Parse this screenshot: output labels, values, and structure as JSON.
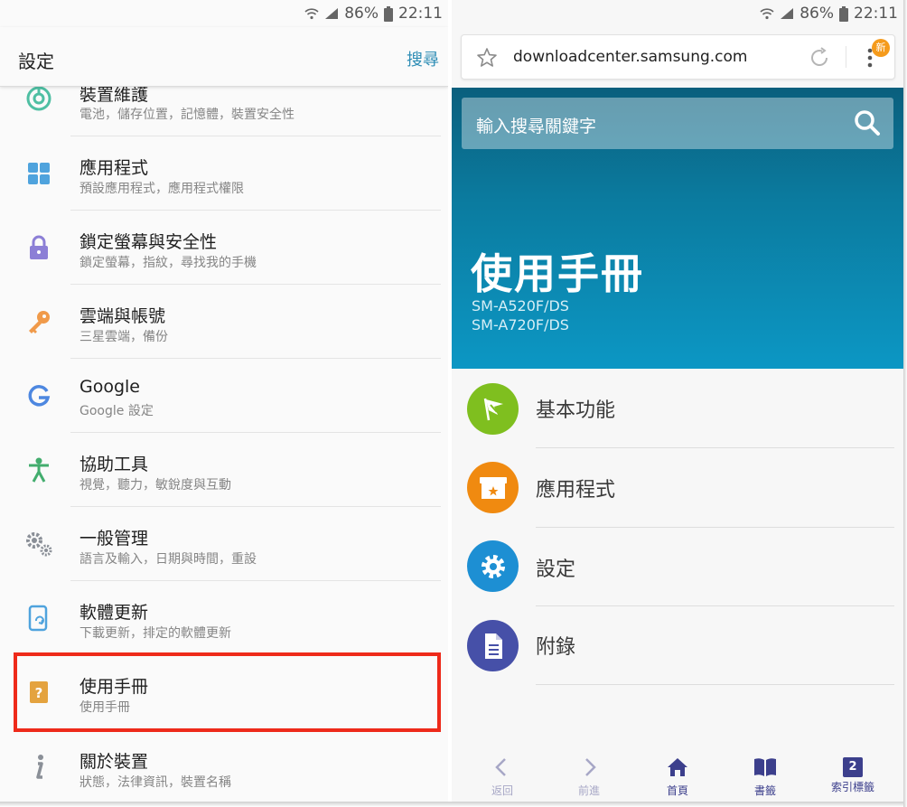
{
  "status_bar": {
    "battery": "86%",
    "time": "22:11"
  },
  "settings": {
    "title": "設定",
    "search_label": "搜尋",
    "items": [
      {
        "title": "裝置維護",
        "subtitle": "電池，儲存位置，記憶體，裝置安全性",
        "icon": "device-maintenance-icon",
        "color": "#4fbfa3"
      },
      {
        "title": "應用程式",
        "subtitle": "預設應用程式，應用程式權限",
        "icon": "apps-grid-icon",
        "color": "#4fa3dd"
      },
      {
        "title": "鎖定螢幕與安全性",
        "subtitle": "鎖定螢幕，指紋，尋找我的手機",
        "icon": "lock-icon",
        "color": "#8c7fd6"
      },
      {
        "title": "雲端與帳號",
        "subtitle": "三星雲端，備份",
        "icon": "key-icon",
        "color": "#f09a4a"
      },
      {
        "title": "Google",
        "subtitle": "Google 設定",
        "icon": "google-icon",
        "color": "#4d87e0"
      },
      {
        "title": "協助工具",
        "subtitle": "視覺，聽力，敏銳度與互動",
        "icon": "accessibility-icon",
        "color": "#43ad6e"
      },
      {
        "title": "一般管理",
        "subtitle": "語言及輸入，日期與時間，重設",
        "icon": "gears-icon",
        "color": "#8a8f97"
      },
      {
        "title": "軟體更新",
        "subtitle": "下載更新，排定的軟體更新",
        "icon": "software-update-icon",
        "color": "#4fa3dd"
      },
      {
        "title": "使用手冊",
        "subtitle": "使用手冊",
        "icon": "user-manual-icon",
        "color": "#e4a33f"
      },
      {
        "title": "關於裝置",
        "subtitle": "狀態，法律資訊，裝置名稱",
        "icon": "info-icon",
        "color": "#8a8f97"
      }
    ]
  },
  "browser": {
    "url": "downloadcenter.samsung.com",
    "new_badge": "新",
    "search_placeholder": "輸入搜尋關鍵字",
    "page_title": "使用手冊",
    "models": [
      "SM-A520F/DS",
      "SM-A720F/DS"
    ],
    "menu": [
      {
        "label": "基本功能",
        "icon": "flag-icon",
        "color": "#7fbf1f"
      },
      {
        "label": "應用程式",
        "icon": "app-box-icon",
        "color": "#f08a10"
      },
      {
        "label": "設定",
        "icon": "gear-icon",
        "color": "#1d8fd3"
      },
      {
        "label": "附錄",
        "icon": "document-icon",
        "color": "#4650a8"
      }
    ],
    "bottom_nav": [
      {
        "label": "返回",
        "icon": "back-arrow-icon",
        "enabled": false
      },
      {
        "label": "前進",
        "icon": "forward-arrow-icon",
        "enabled": false
      },
      {
        "label": "首頁",
        "icon": "home-icon",
        "enabled": true
      },
      {
        "label": "書籤",
        "icon": "bookmark-book-icon",
        "enabled": true
      },
      {
        "label": "索引標籤",
        "icon": "tabs-icon",
        "enabled": true,
        "count": "2"
      }
    ]
  },
  "colors": {
    "accent": "#2e8db5",
    "highlight_border": "#ee2a1a",
    "hero_top": "#0a5f7d",
    "hero_bottom": "#0c97c4"
  }
}
